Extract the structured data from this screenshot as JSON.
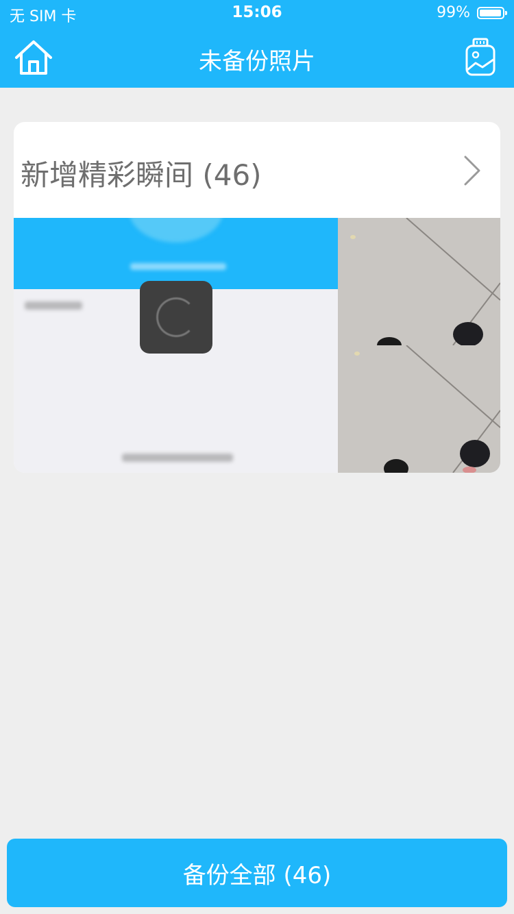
{
  "status_bar": {
    "carrier": "无 SIM 卡",
    "time": "15:06",
    "battery": "99%"
  },
  "nav": {
    "title": "未备份照片",
    "home_icon": "home-icon",
    "album_icon": "photo-album-icon"
  },
  "card": {
    "title": "新增精彩瞬间 (46)",
    "chevron_icon": "chevron-right-icon"
  },
  "backup_button": {
    "label": "备份全部 (46)"
  },
  "colors": {
    "accent": "#1fb7fb",
    "background": "#eeeeee",
    "card_title_text": "#6e6e6e"
  }
}
